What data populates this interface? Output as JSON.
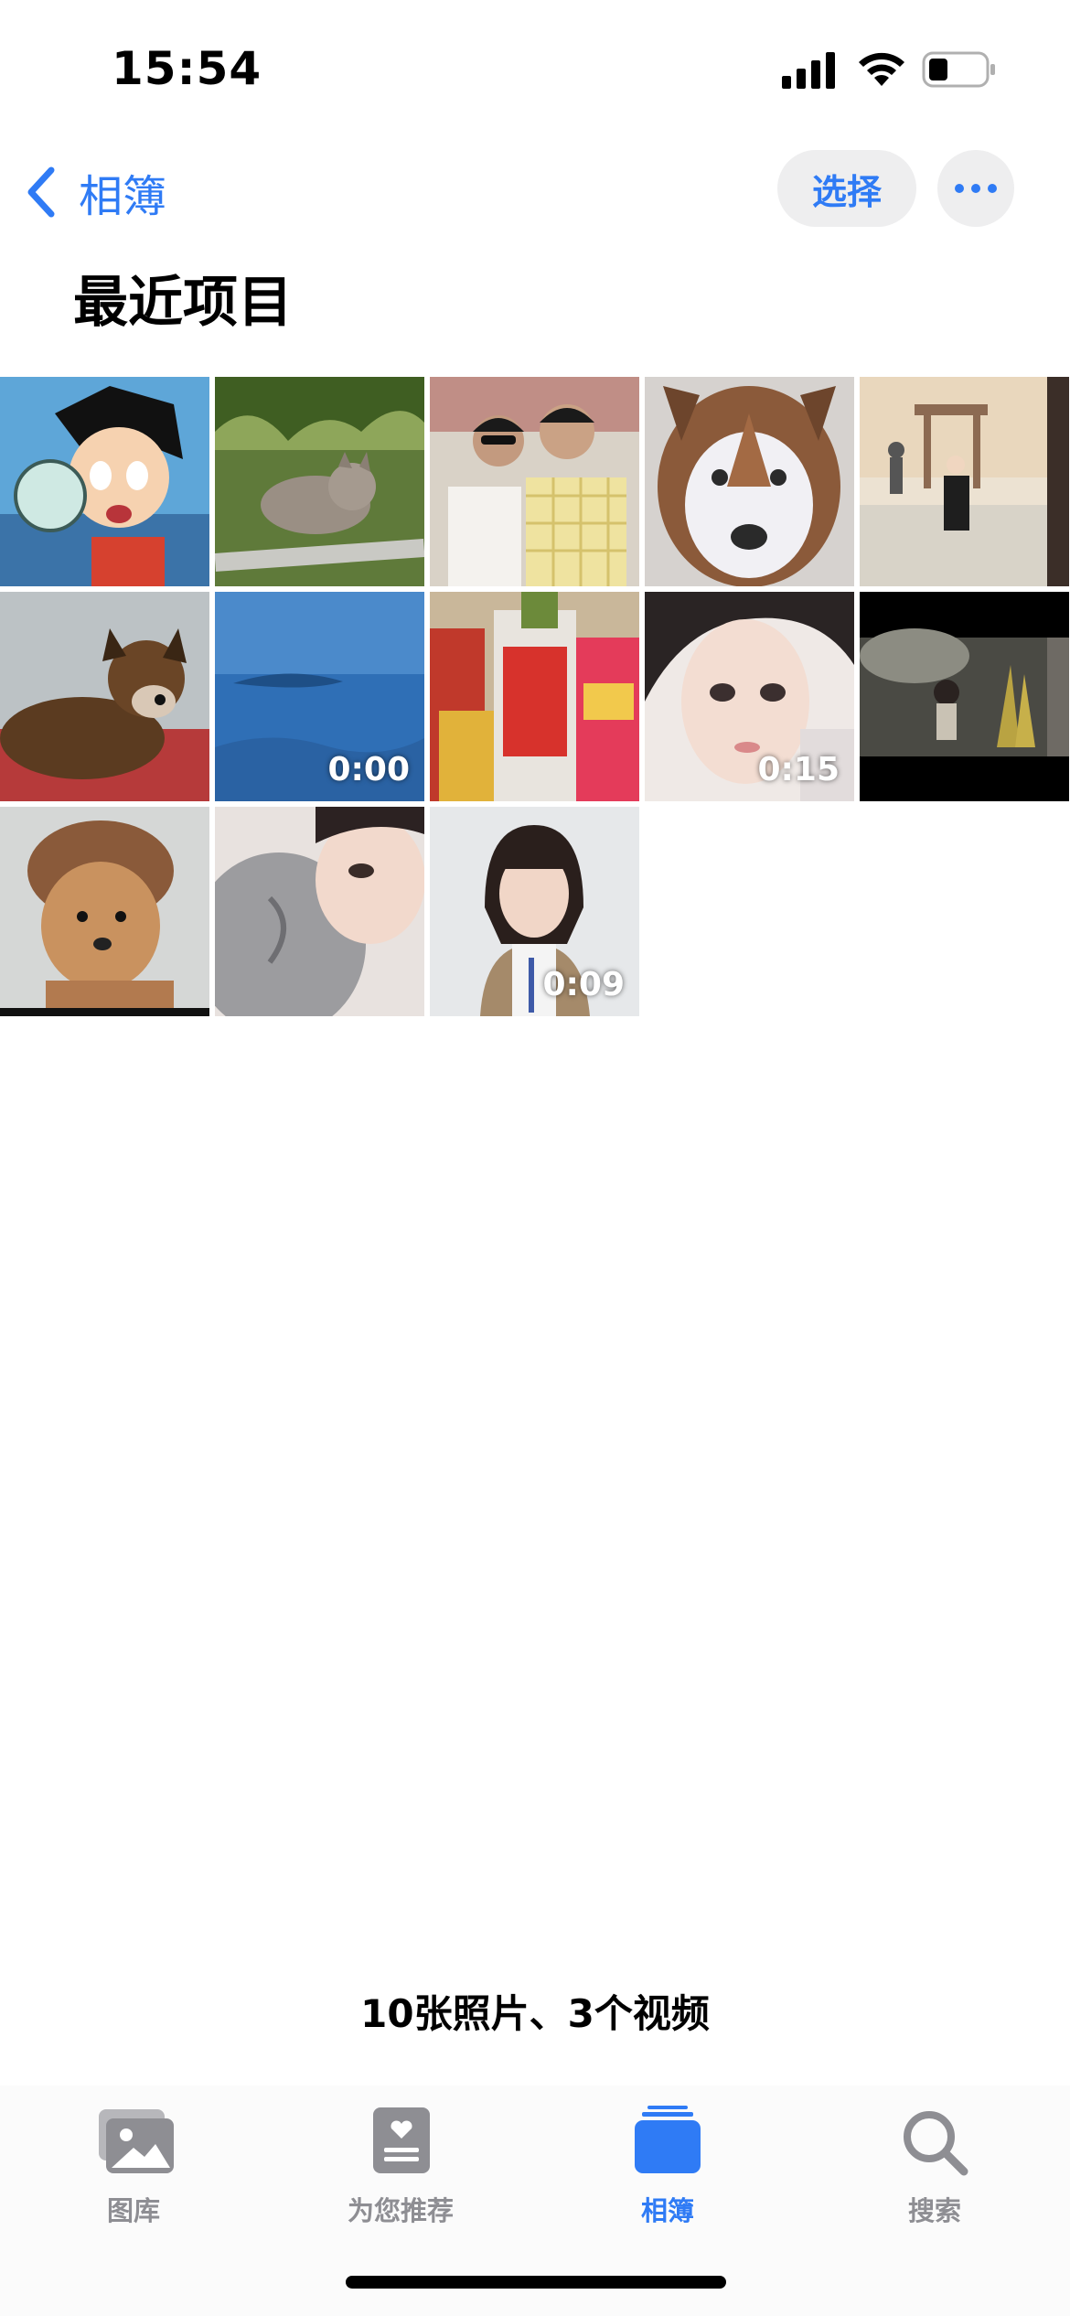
{
  "status_bar": {
    "time": "15:54"
  },
  "nav": {
    "back_label": "相簿",
    "select_label": "选择"
  },
  "page_title": "最近项目",
  "photos": [
    {
      "subject": "cartoon boy with cup",
      "duration": ""
    },
    {
      "subject": "cat on grass",
      "duration": ""
    },
    {
      "subject": "two men on phone",
      "duration": ""
    },
    {
      "subject": "husky dog face",
      "duration": ""
    },
    {
      "subject": "street scene child",
      "duration": ""
    },
    {
      "subject": "dog lying on rug",
      "duration": ""
    },
    {
      "subject": "blue water",
      "duration": "0:00"
    },
    {
      "subject": "snacks packages",
      "duration": ""
    },
    {
      "subject": "girl portrait",
      "duration": "0:15"
    },
    {
      "subject": "girl at night",
      "duration": ""
    },
    {
      "subject": "dog wearing cap",
      "duration": ""
    },
    {
      "subject": "grey cat and girl",
      "duration": ""
    },
    {
      "subject": "woman with badge",
      "duration": "0:09"
    }
  ],
  "summary": "10张照片、3个视频",
  "tabs": [
    {
      "label": "图库",
      "icon": "photo-library-icon",
      "active": false
    },
    {
      "label": "为您推荐",
      "icon": "for-you-icon",
      "active": false
    },
    {
      "label": "相簿",
      "icon": "albums-icon",
      "active": true
    },
    {
      "label": "搜索",
      "icon": "search-icon",
      "active": false
    }
  ],
  "colors": {
    "accent": "#2f7bf5",
    "inactive": "#8e8e93"
  }
}
